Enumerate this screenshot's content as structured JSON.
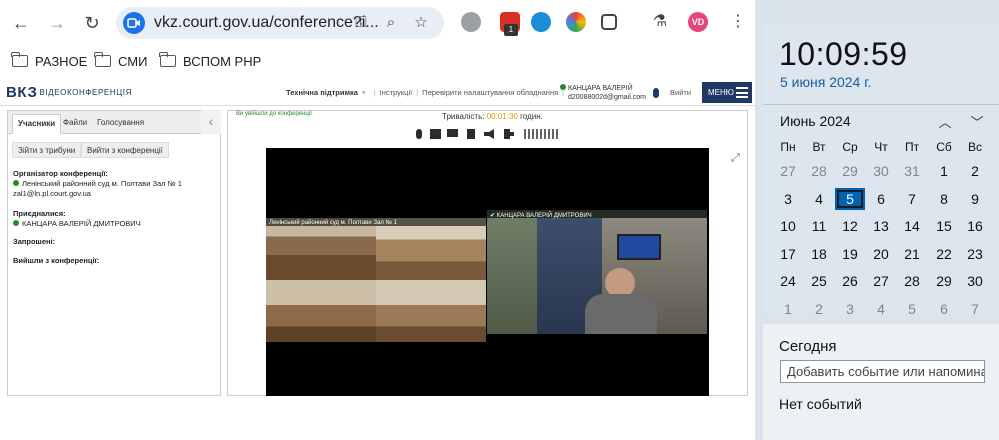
{
  "browser": {
    "url": "vkz.court.gov.ua/conference?i...",
    "profile_initials": "VD",
    "badge_count": "1",
    "bookmarks": [
      {
        "label": "РАЗНОЕ"
      },
      {
        "label": "СМИ"
      },
      {
        "label": "ВСПОМ PHP"
      }
    ]
  },
  "site": {
    "logo_main": "ВКЗ",
    "logo_sub": "ВІДЕОКОНФЕРЕНЦІЯ",
    "links": {
      "support": "Технічна підтримка",
      "instructions": "Інструкції",
      "check": "Перевірити налаштування обладнання"
    },
    "user_name": "КАНЦАРА ВАЛЕРІЙ",
    "user_email": "d20088002d@gmail.com",
    "logout": "Вийти",
    "menu": "МЕНЮ"
  },
  "left": {
    "tabs": [
      "Учасники",
      "Файли",
      "Голосування"
    ],
    "btn_tribune": "Зійти з трибуни",
    "btn_leave": "Вийти з конференції",
    "organizer_h": "Організатор конференції:",
    "organizer_name": "Ленінський районний суд м. Полтави Зал № 1",
    "organizer_email": "zal1@ln.pl.court.gov.ua",
    "joined_h": "Приєдналися:",
    "joined_name": "КАНЦАРА ВАЛЕРІЙ ДМИТРОВИЧ",
    "invited_h": "Запрошені:",
    "left_h": "Вийшли з конференції:"
  },
  "main": {
    "joined_msg": "Ви увійшли до конференції",
    "duration_label": "Тривалість:",
    "duration_value": "00:01:30",
    "duration_unit": "годин.",
    "tile1_label": "Ленінський районний суд м. Полтави Зал № 1",
    "tile2_label": "✔ КАНЦАРА ВАЛЕРІЙ ДМИТРОВИЧ"
  },
  "clock": {
    "time": "10:09:59",
    "date": "5 июня 2024 г.",
    "month": "Июнь 2024",
    "weekdays": [
      "Пн",
      "Вт",
      "Ср",
      "Чт",
      "Пт",
      "Сб",
      "Вс"
    ],
    "weeks": [
      [
        "27",
        "28",
        "29",
        "30",
        "31",
        "1",
        "2"
      ],
      [
        "3",
        "4",
        "5",
        "6",
        "7",
        "8",
        "9"
      ],
      [
        "10",
        "11",
        "12",
        "13",
        "14",
        "15",
        "16"
      ],
      [
        "17",
        "18",
        "19",
        "20",
        "21",
        "22",
        "23"
      ],
      [
        "24",
        "25",
        "26",
        "27",
        "28",
        "29",
        "30"
      ],
      [
        "1",
        "2",
        "3",
        "4",
        "5",
        "6",
        "7"
      ]
    ],
    "today_label": "Сегодня",
    "add_event_placeholder": "Добавить событие или напоминание",
    "no_events": "Нет событий"
  }
}
